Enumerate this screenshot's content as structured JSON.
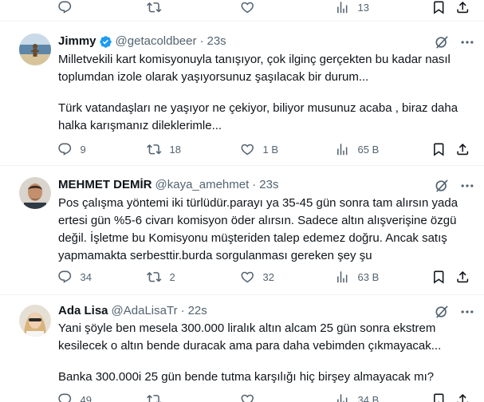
{
  "top_actions": {
    "views": "13"
  },
  "tweets": [
    {
      "name": "Jimmy",
      "handle": "@getacoldbeer",
      "separator": "·",
      "time": "23s",
      "lines": [
        "Milletvekili kart komisyonuyla tanışıyor, çok ilginç gerçekten bu kadar nasıl",
        "toplumdan izole olarak yaşıyorsunuz şaşılacak bir durum...",
        "",
        "Türk vatandaşları ne yaşıyor ne çekiyor, biliyor musunuz acaba , biraz daha",
        "halka karışmanız dileklerimle..."
      ],
      "replies": "9",
      "reposts": "18",
      "likes": "1 B",
      "views": "65 B"
    },
    {
      "name": "MEHMET DEMİR",
      "handle": "@kaya_amehmet",
      "separator": "·",
      "time": "23s",
      "lines": [
        "Pos çalışma yöntemi iki türlüdür.parayı ya 35-45 gün sonra tam alırsın yada",
        "ertesi gün %5-6 civarı komisyon öder  alırsın. Sadece altın alışverişine özgü",
        "değil. İşletme bu Komisyonu müşteriden talep edemez doğru. Ancak satış",
        "yapmamakta serbesttir.burda sorgulanması gereken şey şu"
      ],
      "replies": "34",
      "reposts": "2",
      "likes": "32",
      "views": "63 B"
    },
    {
      "name": "Ada Lisa",
      "handle": "@AdaLisaTr",
      "separator": "·",
      "time": "22s",
      "lines": [
        "Yani şöyle ben mesela 300.000 liralık altın alcam 25 gün sonra ekstrem",
        "kesilecek o altın bende duracak ama para daha vebimden çıkmayacak...",
        "",
        "Banka 300.000i 25 gün bende tutma karşılığı hiç birşey almayacak mı?"
      ],
      "replies": "49",
      "reposts": "",
      "likes": "",
      "views": "34 B"
    }
  ],
  "icons": {
    "reply": "reply-icon",
    "repost": "repost-icon",
    "like": "like-icon",
    "views": "views-icon",
    "bookmark": "bookmark-icon",
    "share": "share-icon",
    "grok": "grok-icon",
    "more": "more-icon",
    "verified": "verified-badge-icon"
  },
  "colors": {
    "text": "#0f1419",
    "secondary": "#536471",
    "verified": "#1d9bf0",
    "divider": "#eff3f4"
  }
}
